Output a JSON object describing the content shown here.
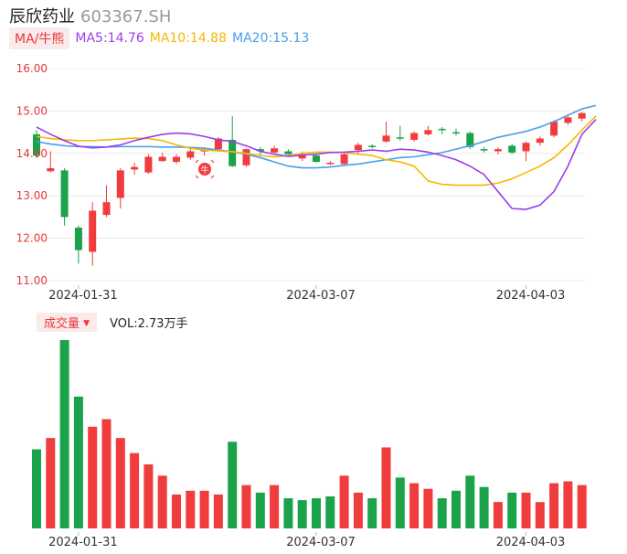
{
  "header": {
    "name": "辰欣药业",
    "code": "603367.SH"
  },
  "ma": {
    "tag": "MA/牛熊",
    "ma5": "MA5:14.76",
    "ma10": "MA10:14.88",
    "ma20": "MA20:15.13"
  },
  "volume": {
    "tag": "成交量",
    "arrow": "▼",
    "value": "VOL:2.73万手"
  },
  "colors": {
    "up": "#f03c3c",
    "down": "#1aa34a",
    "ma5": "#9b3dea",
    "ma10": "#f5b800",
    "ma20": "#4a9eea"
  },
  "chart_data": [
    {
      "type": "candlestick",
      "ylim": [
        11.0,
        16.0
      ],
      "yticks": [
        "16.00",
        "15.00",
        "14.00",
        "13.00",
        "12.00",
        "11.00"
      ],
      "xtick_labels": [
        "2024-01-31",
        "2024-03-07",
        "2024-04-03"
      ],
      "xtick_index": [
        3,
        20,
        35
      ],
      "candles": [
        {
          "o": 14.45,
          "c": 13.95,
          "h": 14.55,
          "l": 13.9
        },
        {
          "o": 13.58,
          "c": 13.65,
          "h": 14.05,
          "l": 13.55
        },
        {
          "o": 13.6,
          "c": 12.5,
          "h": 13.65,
          "l": 12.3
        },
        {
          "o": 12.25,
          "c": 11.72,
          "h": 12.3,
          "l": 11.4
        },
        {
          "o": 11.68,
          "c": 12.65,
          "h": 12.85,
          "l": 11.35
        },
        {
          "o": 12.55,
          "c": 12.85,
          "h": 13.25,
          "l": 12.5
        },
        {
          "o": 12.95,
          "c": 13.6,
          "h": 13.65,
          "l": 12.7
        },
        {
          "o": 13.62,
          "c": 13.68,
          "h": 13.78,
          "l": 13.5
        },
        {
          "o": 13.55,
          "c": 13.92,
          "h": 13.98,
          "l": 13.52
        },
        {
          "o": 13.82,
          "c": 13.92,
          "h": 14.02,
          "l": 13.8
        },
        {
          "o": 13.8,
          "c": 13.92,
          "h": 13.98,
          "l": 13.75
        },
        {
          "o": 13.9,
          "c": 14.05,
          "h": 14.12,
          "l": 13.85
        },
        {
          "o": 14.05,
          "c": 14.08,
          "h": 14.15,
          "l": 13.95
        },
        {
          "o": 14.1,
          "c": 14.35,
          "h": 14.38,
          "l": 14.05
        },
        {
          "o": 14.32,
          "c": 13.7,
          "h": 14.88,
          "l": 13.68
        },
        {
          "o": 13.72,
          "c": 14.1,
          "h": 14.12,
          "l": 13.68
        },
        {
          "o": 14.1,
          "c": 14.05,
          "h": 14.15,
          "l": 13.95
        },
        {
          "o": 14.02,
          "c": 14.12,
          "h": 14.18,
          "l": 14.0
        },
        {
          "o": 14.05,
          "c": 13.98,
          "h": 14.1,
          "l": 13.92
        },
        {
          "o": 13.88,
          "c": 13.98,
          "h": 14.05,
          "l": 13.82
        },
        {
          "o": 13.95,
          "c": 13.8,
          "h": 14.0,
          "l": 13.78
        },
        {
          "o": 13.78,
          "c": 13.78,
          "h": 13.82,
          "l": 13.72
        },
        {
          "o": 13.75,
          "c": 13.98,
          "h": 14.02,
          "l": 13.72
        },
        {
          "o": 14.08,
          "c": 14.2,
          "h": 14.25,
          "l": 14.0
        },
        {
          "o": 14.18,
          "c": 14.16,
          "h": 14.22,
          "l": 14.12
        },
        {
          "o": 14.28,
          "c": 14.42,
          "h": 14.75,
          "l": 14.25
        },
        {
          "o": 14.38,
          "c": 14.36,
          "h": 14.65,
          "l": 14.3
        },
        {
          "o": 14.32,
          "c": 14.48,
          "h": 14.52,
          "l": 14.28
        },
        {
          "o": 14.45,
          "c": 14.55,
          "h": 14.65,
          "l": 14.42
        },
        {
          "o": 14.58,
          "c": 14.57,
          "h": 14.62,
          "l": 14.45
        },
        {
          "o": 14.5,
          "c": 14.49,
          "h": 14.58,
          "l": 14.42
        },
        {
          "o": 14.48,
          "c": 14.15,
          "h": 14.52,
          "l": 14.1
        },
        {
          "o": 14.1,
          "c": 14.09,
          "h": 14.15,
          "l": 14.02
        },
        {
          "o": 14.05,
          "c": 14.1,
          "h": 14.14,
          "l": 13.98
        },
        {
          "o": 14.18,
          "c": 14.02,
          "h": 14.22,
          "l": 13.98
        },
        {
          "o": 14.05,
          "c": 14.25,
          "h": 14.28,
          "l": 13.82
        },
        {
          "o": 14.25,
          "c": 14.35,
          "h": 14.4,
          "l": 14.18
        },
        {
          "o": 14.42,
          "c": 14.75,
          "h": 14.78,
          "l": 14.38
        },
        {
          "o": 14.72,
          "c": 14.85,
          "h": 14.88,
          "l": 14.68
        },
        {
          "o": 14.82,
          "c": 14.95,
          "h": 14.98,
          "l": 14.75
        }
      ],
      "ma5": [
        14.62,
        14.45,
        14.3,
        14.17,
        14.13,
        14.15,
        14.2,
        14.3,
        14.38,
        14.45,
        14.48,
        14.46,
        14.4,
        14.32,
        14.28,
        14.18,
        14.05,
        13.98,
        13.93,
        13.96,
        13.98,
        14.02,
        14.03,
        14.05,
        14.08,
        14.05,
        14.1,
        14.08,
        14.03,
        13.95,
        13.85,
        13.7,
        13.5,
        13.1,
        12.7,
        12.68,
        12.78,
        13.1,
        13.7,
        14.45,
        14.8
      ],
      "ma10": [
        14.4,
        14.35,
        14.32,
        14.3,
        14.3,
        14.32,
        14.34,
        14.36,
        14.35,
        14.3,
        14.2,
        14.12,
        14.08,
        14.06,
        14.04,
        14.0,
        13.95,
        13.92,
        13.95,
        14.0,
        14.03,
        14.03,
        14.02,
        13.98,
        13.95,
        13.85,
        13.8,
        13.7,
        13.35,
        13.27,
        13.25,
        13.25,
        13.25,
        13.3,
        13.4,
        13.55,
        13.7,
        13.9,
        14.2,
        14.55,
        14.88
      ],
      "ma20": [
        14.28,
        14.22,
        14.18,
        14.16,
        14.16,
        14.15,
        14.16,
        14.16,
        14.16,
        14.15,
        14.15,
        14.14,
        14.12,
        14.08,
        14.04,
        13.98,
        13.9,
        13.8,
        13.7,
        13.66,
        13.66,
        13.68,
        13.72,
        13.75,
        13.8,
        13.85,
        13.9,
        13.92,
        13.97,
        14.02,
        14.1,
        14.18,
        14.28,
        14.38,
        14.45,
        14.52,
        14.62,
        14.75,
        14.9,
        15.05,
        15.13
      ]
    },
    {
      "type": "bar",
      "title": "成交量",
      "values": [
        0.42,
        0.48,
        1.0,
        0.7,
        0.54,
        0.58,
        0.48,
        0.4,
        0.34,
        0.28,
        0.18,
        0.2,
        0.2,
        0.18,
        0.46,
        0.23,
        0.19,
        0.23,
        0.16,
        0.15,
        0.16,
        0.17,
        0.28,
        0.19,
        0.16,
        0.43,
        0.27,
        0.24,
        0.21,
        0.16,
        0.2,
        0.28,
        0.22,
        0.14,
        0.19,
        0.19,
        0.14,
        0.24,
        0.25,
        0.23
      ],
      "up": [
        false,
        true,
        false,
        false,
        true,
        true,
        true,
        true,
        true,
        true,
        true,
        true,
        true,
        true,
        false,
        true,
        false,
        true,
        false,
        false,
        false,
        false,
        true,
        true,
        false,
        true,
        false,
        true,
        true,
        false,
        false,
        false,
        false,
        true,
        false,
        true,
        true,
        true,
        true,
        true
      ]
    }
  ]
}
